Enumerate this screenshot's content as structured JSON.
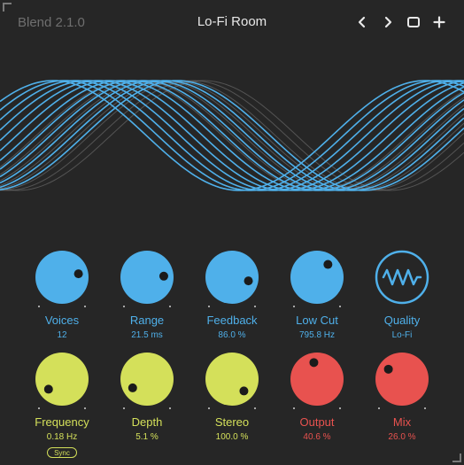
{
  "header": {
    "version": "Blend 2.1.0",
    "preset_name": "Lo-Fi Room",
    "prev_icon": "chevron-left-icon",
    "next_icon": "chevron-right-icon",
    "window_icon": "window-icon",
    "add_icon": "plus-icon"
  },
  "colors": {
    "background": "#262626",
    "blue": "#4fb0ea",
    "yellow": "#d4e05a",
    "red": "#e8524f",
    "wave_blue": "#4fb0ea",
    "wave_grey": "#7a7a7a"
  },
  "knobs_row1": [
    {
      "label": "Voices",
      "value": "12",
      "color": "blue",
      "level": 0.79
    },
    {
      "label": "Range",
      "value": "21.5 ms",
      "color": "blue",
      "level": 0.82
    },
    {
      "label": "Feedback",
      "value": "86.0 %",
      "color": "blue",
      "level": 0.88
    },
    {
      "label": "Low Cut",
      "value": "795.8 Hz",
      "color": "blue",
      "level": 0.65
    },
    {
      "label": "Quality",
      "value": "Lo-Fi",
      "color": "blue",
      "icon": "wave-icon"
    }
  ],
  "knobs_row2": [
    {
      "label": "Frequency",
      "value": "0.18 Hz",
      "color": "yellow",
      "level": 0.03,
      "sync_label": "Sync"
    },
    {
      "label": "Depth",
      "value": "5.1 %",
      "color": "yellow",
      "level": 0.05
    },
    {
      "label": "Stereo",
      "value": "100.0 %",
      "color": "yellow",
      "level": 1.0
    },
    {
      "label": "Output",
      "value": "40.6 %",
      "color": "red",
      "level": 0.46
    },
    {
      "label": "Mix",
      "value": "26.0 %",
      "color": "red",
      "level": 0.3
    }
  ]
}
